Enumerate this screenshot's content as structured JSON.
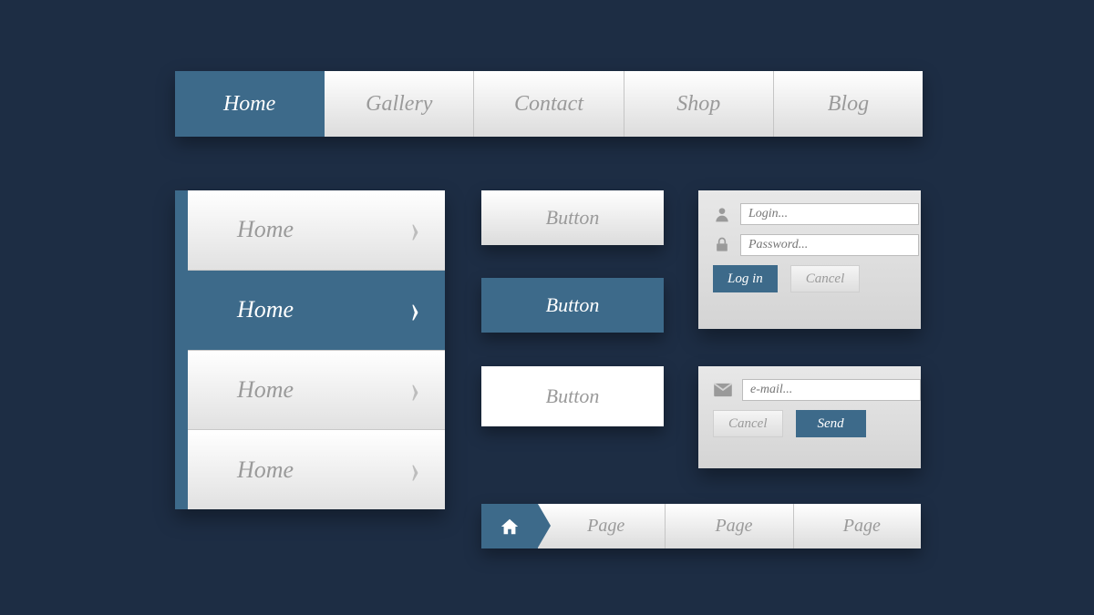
{
  "colors": {
    "accent": "#3d6a8a",
    "bg": "#1d2d44",
    "muted": "#9a9a9a"
  },
  "topnav": {
    "items": [
      {
        "label": "Home",
        "active": true
      },
      {
        "label": "Gallery",
        "active": false
      },
      {
        "label": "Contact",
        "active": false
      },
      {
        "label": "Shop",
        "active": false
      },
      {
        "label": "Blog",
        "active": false
      }
    ]
  },
  "sidenav": {
    "items": [
      {
        "label": "Home",
        "active": false
      },
      {
        "label": "Home",
        "active": true
      },
      {
        "label": "Home",
        "active": false
      },
      {
        "label": "Home",
        "active": false
      }
    ]
  },
  "buttons": {
    "grey": "Button",
    "blue": "Button",
    "white": "Button"
  },
  "login": {
    "login_placeholder": "Login...",
    "password_placeholder": "Password...",
    "login_btn": "Log in",
    "cancel_btn": "Cancel"
  },
  "email": {
    "placeholder": "e-mail...",
    "cancel_btn": "Cancel",
    "send_btn": "Send"
  },
  "breadcrumb": {
    "items": [
      {
        "label": "Page"
      },
      {
        "label": "Page"
      },
      {
        "label": "Page"
      }
    ]
  }
}
